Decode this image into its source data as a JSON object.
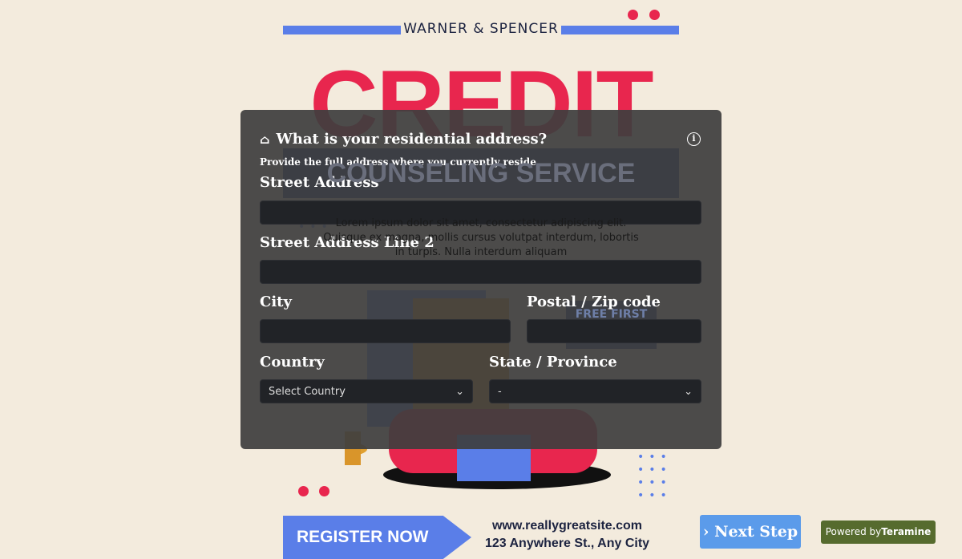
{
  "poster": {
    "brand": "WARNER & SPENCER",
    "headline": "CREDIT",
    "banner": "COUNSELING SERVICE",
    "body": "Lorem ipsum dolor sit amet, consectetur adipiscing elit. Quisque ex magna, mollis cursus volutpat interdum, lobortis in turpis. Nulla interdum aliquam",
    "badge": "FREE FIRST",
    "register": "REGISTER NOW",
    "website": "www.reallygreatsite.com",
    "address": "123 Anywhere St., Any City"
  },
  "form": {
    "title": "What is your residential address?",
    "subtitle": "Provide the full address where you currently reside.",
    "fields": {
      "street": {
        "label": "Street Address",
        "value": ""
      },
      "street2": {
        "label": "Street Address Line 2",
        "value": ""
      },
      "city": {
        "label": "City",
        "value": ""
      },
      "postal": {
        "label": "Postal / Zip code",
        "value": ""
      },
      "country": {
        "label": "Country",
        "value": "Select Country"
      },
      "state": {
        "label": "State / Province",
        "value": "-"
      }
    }
  },
  "next_label": "Next Step",
  "powered": {
    "prefix": "Powered by",
    "brand": "Teramine"
  },
  "colors": {
    "accent": "#e8264e",
    "blue": "#5a7ee8",
    "navy": "#1e3a8a",
    "next": "#5b9bea",
    "powered": "#566b2e"
  }
}
